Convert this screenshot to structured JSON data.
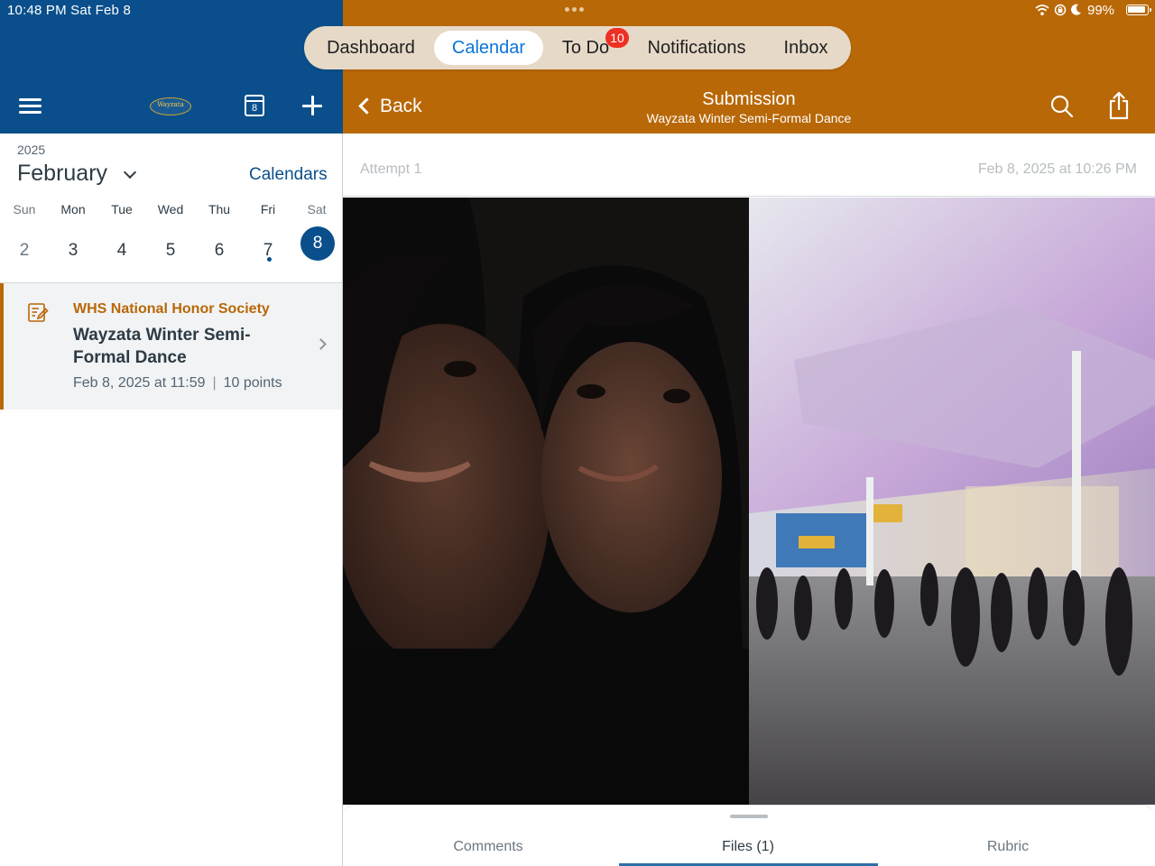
{
  "status_bar": {
    "time_date": "10:48 PM   Sat Feb 8",
    "battery": "99%"
  },
  "tabs": [
    {
      "label": "Dashboard",
      "active": false
    },
    {
      "label": "Calendar",
      "active": true
    },
    {
      "label": "To Do",
      "active": false,
      "badge": "10"
    },
    {
      "label": "Notifications",
      "active": false
    },
    {
      "label": "Inbox",
      "active": false
    }
  ],
  "left": {
    "icons": [
      "menu-icon",
      "school-logo",
      "calendar-today-icon",
      "plus-icon"
    ],
    "today_number": "8",
    "year": "2025",
    "month": "February",
    "calendars_link": "Calendars",
    "weekdays": [
      "Sun",
      "Mon",
      "Tue",
      "Wed",
      "Thu",
      "Fri",
      "Sat"
    ],
    "days": [
      "2",
      "3",
      "4",
      "5",
      "6",
      "7",
      "8"
    ],
    "selected_day": "8",
    "event": {
      "course": "WHS National Honor Society",
      "title": "Wayzata Winter Semi-Formal Dance",
      "date": "Feb 8, 2025 at 11:59",
      "points": "10 points"
    }
  },
  "right": {
    "back_label": "Back",
    "title": "Submission",
    "subtitle": "Wayzata Winter Semi-Formal Dance",
    "attempt_label": "Attempt 1",
    "attempt_date": "Feb 8, 2025 at 10:26 PM",
    "bottom_tabs": [
      {
        "label": "Comments",
        "active": false
      },
      {
        "label": "Files (1)",
        "active": true
      },
      {
        "label": "Rubric",
        "active": false
      }
    ]
  },
  "colors": {
    "left_header": "#0a4f8c",
    "right_header": "#b86807",
    "accent_blue": "#0a74d9",
    "badge_red": "#ee3024"
  }
}
